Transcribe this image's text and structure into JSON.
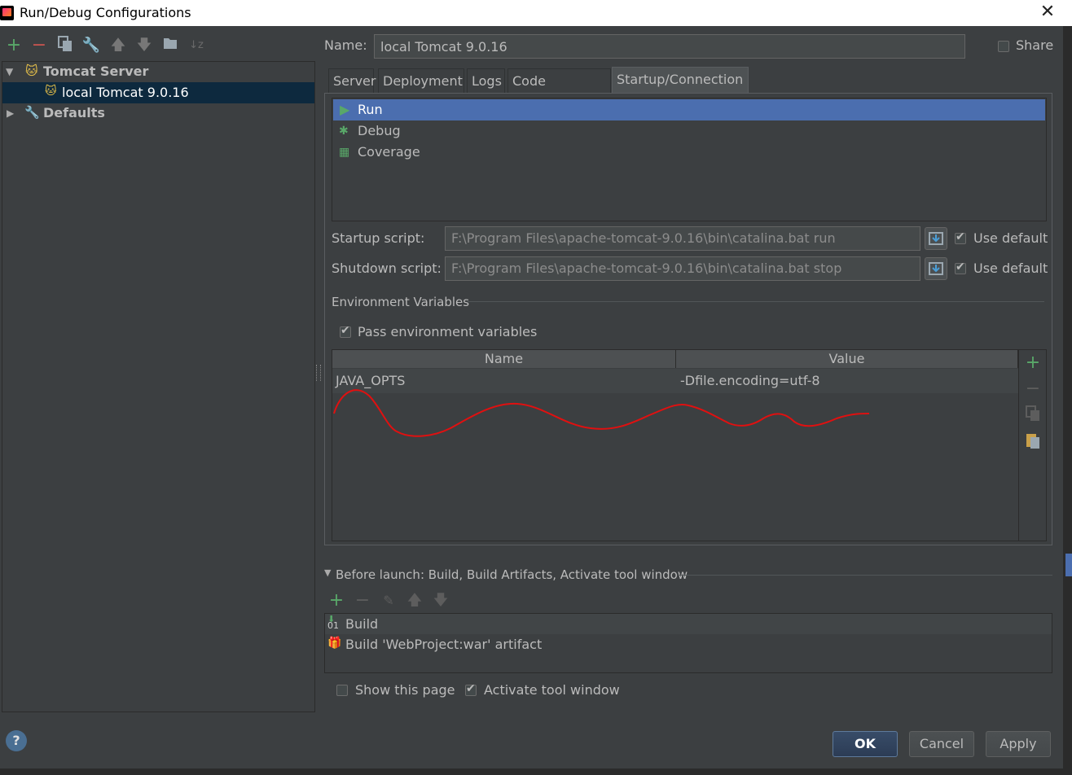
{
  "window": {
    "title": "Run/Debug Configurations"
  },
  "tree": {
    "items": [
      {
        "label": "Tomcat Server"
      },
      {
        "label": "local Tomcat 9.0.16"
      },
      {
        "label": "Defaults"
      }
    ]
  },
  "config": {
    "name_label": "Name:",
    "name_value": "local Tomcat 9.0.16",
    "share_label": "Share"
  },
  "tabs": [
    {
      "label": "Server"
    },
    {
      "label": "Deployment"
    },
    {
      "label": "Logs"
    },
    {
      "label": "Code Coverage"
    },
    {
      "label": "Startup/Connection"
    }
  ],
  "modes": [
    {
      "label": "Run"
    },
    {
      "label": "Debug"
    },
    {
      "label": "Coverage"
    }
  ],
  "scripts": {
    "startup_label": "Startup script:",
    "startup_value": "F:\\Program Files\\apache-tomcat-9.0.16\\bin\\catalina.bat run",
    "shutdown_label": "Shutdown script:",
    "shutdown_value": "F:\\Program Files\\apache-tomcat-9.0.16\\bin\\catalina.bat stop",
    "use_default_label": "Use default"
  },
  "env": {
    "section_label": "Environment Variables",
    "pass_label": "Pass environment variables",
    "columns": [
      "Name",
      "Value"
    ],
    "rows": [
      {
        "name": "JAVA_OPTS",
        "value": "-Dfile.encoding=utf-8"
      }
    ]
  },
  "before_launch": {
    "label": "Before launch: Build, Build Artifacts, Activate tool window",
    "items": [
      {
        "label": "Build"
      },
      {
        "label": "Build 'WebProject:war' artifact"
      }
    ]
  },
  "footer": {
    "show_page_label": "Show this page",
    "activate_label": "Activate tool window",
    "ok_label": "OK",
    "cancel_label": "Cancel",
    "apply_label": "Apply",
    "help_label": "?"
  },
  "colors": {
    "accent_green": "#59a869",
    "remove_red": "#c75450",
    "selection_blue": "#4b6eaf",
    "annotation_red": "#e01010"
  }
}
